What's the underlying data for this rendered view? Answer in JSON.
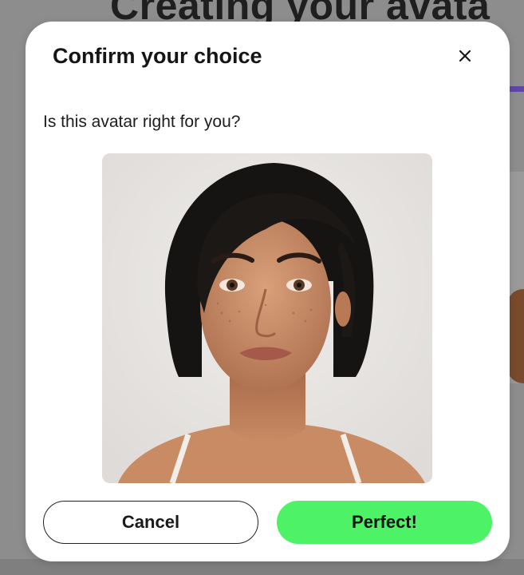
{
  "background": {
    "heading": "Creating your avata"
  },
  "modal": {
    "title": "Confirm your choice",
    "close_icon": "close-icon",
    "question": "Is this avatar right for you?",
    "cancel_label": "Cancel",
    "confirm_label": "Perfect!"
  },
  "colors": {
    "confirm_button": "#4ef266",
    "progress_accent": "#5d47a8",
    "overlay": "#8d8d8d"
  }
}
